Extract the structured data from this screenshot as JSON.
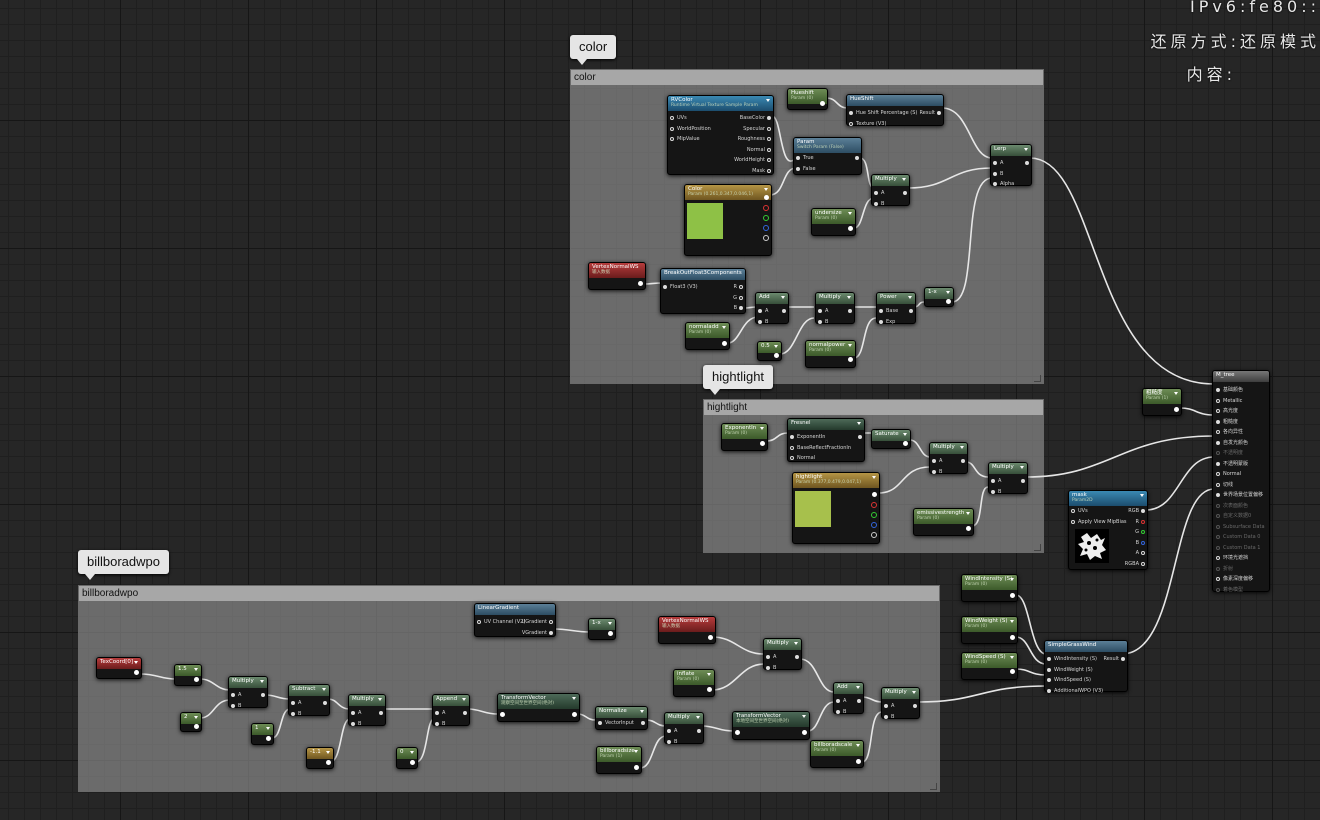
{
  "overlay": {
    "line1": "IPv6:fe80::",
    "line2": "还原方式:还原模式",
    "line3": "内容:"
  },
  "comments": {
    "color": {
      "bubble": "color",
      "header": "color"
    },
    "hightlight": {
      "bubble": "hightlight",
      "header": "hightlight"
    },
    "billboradwpo": {
      "bubble": "billboradwpo",
      "header": "billboradwpo"
    }
  },
  "nodes": {
    "rvt": {
      "title": "RVColor",
      "sub": "Runtime Virtual Texture Sample Param",
      "in": [
        "UVs",
        "WorldPosition",
        "MipValue"
      ],
      "out": [
        "BaseColor",
        "Specular",
        "Roughness",
        "Normal",
        "WorldHeight",
        "Mask"
      ]
    },
    "hueshift_param": {
      "title": "Hueshift",
      "sub": "Param (0)"
    },
    "hueshift": {
      "title": "HueShift",
      "in": [
        "Hue Shift Percentage (S)",
        "Texture (V3)"
      ],
      "out": [
        "Result"
      ]
    },
    "switch_param": {
      "title": "Param",
      "sub": "Switch Param (False)",
      "in": [
        "True",
        "False"
      ]
    },
    "color": {
      "title": "Color",
      "sub": "Param (0.261,0.347,0.046,1)",
      "swatch": "#8ec146"
    },
    "multiply_c1": {
      "title": "Multiply",
      "in": [
        "A",
        "B"
      ]
    },
    "undersize": {
      "title": "undersize",
      "sub": "Param (0)"
    },
    "lerp": {
      "title": "Lerp",
      "in": [
        "A",
        "B",
        "Alpha"
      ]
    },
    "vertex_normal_1": {
      "title": "VertexNormalWS",
      "sub": "输入数据"
    },
    "breakout": {
      "title": "BreakOutFloat3Components",
      "in": [
        "Float3 (V3)"
      ],
      "out": [
        "R",
        "G",
        "B"
      ]
    },
    "add_c": {
      "title": "Add",
      "in": [
        "A",
        "B"
      ]
    },
    "multiply_c2": {
      "title": "Multiply",
      "in": [
        "A",
        "B"
      ]
    },
    "power": {
      "title": "Power",
      "in": [
        "Base",
        "Exp"
      ]
    },
    "one_minus_c": {
      "title": "1-x"
    },
    "normaladd": {
      "title": "normaladd",
      "sub": "Param (0)"
    },
    "const_05": {
      "title": "0.5"
    },
    "normalpower": {
      "title": "normalpower",
      "sub": "Param (0)"
    },
    "m_tree": {
      "title": "M_tree",
      "rows": [
        {
          "label": "基础颜色",
          "on": true,
          "dim": false
        },
        {
          "label": "Metallic",
          "on": false,
          "dim": false
        },
        {
          "label": "高光度",
          "on": false,
          "dim": false
        },
        {
          "label": "粗糙度",
          "on": true,
          "dim": false
        },
        {
          "label": "各向异性",
          "on": false,
          "dim": false
        },
        {
          "label": "自发光颜色",
          "on": true,
          "dim": false
        },
        {
          "label": "不透明度",
          "on": false,
          "dim": true
        },
        {
          "label": "不透明蒙版",
          "on": true,
          "dim": false
        },
        {
          "label": "Normal",
          "on": false,
          "dim": false
        },
        {
          "label": "切线",
          "on": false,
          "dim": false
        },
        {
          "label": "世界场景位置偏移",
          "on": true,
          "dim": false
        },
        {
          "label": "次表面颜色",
          "on": false,
          "dim": true
        },
        {
          "label": "自定义数据0",
          "on": false,
          "dim": true
        },
        {
          "label": "Subsurface Data",
          "on": false,
          "dim": true
        },
        {
          "label": "Custom Data 0",
          "on": false,
          "dim": true
        },
        {
          "label": "Custom Data 1",
          "on": false,
          "dim": true
        },
        {
          "label": "环境光遮挡",
          "on": false,
          "dim": false
        },
        {
          "label": "折射",
          "on": false,
          "dim": true
        },
        {
          "label": "像素深度偏移",
          "on": false,
          "dim": false
        },
        {
          "label": "着色模型",
          "on": false,
          "dim": true
        }
      ]
    },
    "roughness": {
      "title": "粗糙度",
      "sub": "Param (1)"
    },
    "exponentin": {
      "title": "ExponentIn",
      "sub": "Param (0)"
    },
    "fresnel": {
      "title": "Fresnel",
      "in": [
        "ExponentIn",
        "BaseReflectFractionIn",
        "Normal"
      ]
    },
    "saturate": {
      "title": "Saturate"
    },
    "multiply_h1": {
      "title": "Multiply",
      "in": [
        "A",
        "B"
      ]
    },
    "multiply_h2": {
      "title": "Multiply",
      "in": [
        "A",
        "B"
      ]
    },
    "hightlight": {
      "title": "hightlight",
      "sub": "Param (0.377,0.479,0.047,1)",
      "swatch": "#a7c04c"
    },
    "emissive": {
      "title": "emissivestrength",
      "sub": "Param (0)"
    },
    "mask": {
      "title": "mask",
      "sub": "Param2D",
      "in": [
        "UVs",
        "Apply View MipBias"
      ],
      "out": [
        "RGB",
        "R",
        "G",
        "B",
        "A",
        "RGBA"
      ]
    },
    "wind_intensity": {
      "title": "WindIntensity (S)",
      "sub": "Param (0)"
    },
    "wind_weight": {
      "title": "WindWeight (S)",
      "sub": "Param (0)"
    },
    "wind_speed": {
      "title": "WindSpeed (S)",
      "sub": "Param (0)"
    },
    "simplegrass": {
      "title": "SimpleGrassWind",
      "in": [
        "WindIntensity (S)",
        "WindWeight (S)",
        "WindSpeed (S)",
        "AdditionalWPO (V3)"
      ],
      "out": [
        "Result"
      ]
    },
    "texcoord": {
      "title": "TexCoord[0]"
    },
    "const_1_a": {
      "title": "1.5"
    },
    "const_2": {
      "title": "2"
    },
    "multiply_b1": {
      "title": "Multiply",
      "in": [
        "A",
        "B"
      ]
    },
    "subtract": {
      "title": "Subtract",
      "in": [
        "A",
        "B"
      ]
    },
    "const_1_b": {
      "title": "1"
    },
    "multiply_b2": {
      "title": "Multiply",
      "in": [
        "A",
        "B"
      ]
    },
    "const_neg1": {
      "title": "-1.1"
    },
    "append": {
      "title": "Append",
      "in": [
        "A",
        "B"
      ]
    },
    "const_0": {
      "title": "0"
    },
    "lineargradient": {
      "title": "LinearGradient",
      "in": [
        "UV Channel (V2)"
      ],
      "out": [
        "UGradient",
        "VGradient"
      ]
    },
    "one_minus_b": {
      "title": "1-x"
    },
    "transform1": {
      "title": "TransformVector",
      "sub": "观察空间至世界空间(绝对)"
    },
    "normalize": {
      "title": "Normalize",
      "in": [
        "VectorInput"
      ]
    },
    "vertex_normal_2": {
      "title": "VertexNormalWS",
      "sub": "输入数据"
    },
    "multiply_b3": {
      "title": "Multiply",
      "in": [
        "A",
        "B"
      ]
    },
    "inflate": {
      "title": "inflate",
      "sub": "Param (0)"
    },
    "multiply_b4": {
      "title": "Multiply",
      "in": [
        "A",
        "B"
      ]
    },
    "transform2": {
      "title": "TransformVector",
      "sub": "本地空间至世界空间(绝对)"
    },
    "billboradsize": {
      "title": "billboradsize",
      "sub": "Param (1)"
    },
    "add_b": {
      "title": "Add",
      "in": [
        "A",
        "B"
      ]
    },
    "billboradscale": {
      "title": "billboradscale",
      "sub": "Param (0)"
    },
    "multiply_b5": {
      "title": "Multiply",
      "in": [
        "A",
        "B"
      ]
    }
  },
  "colors": {
    "param_header": "#5d7e47",
    "function_header": "#3d6580",
    "input_header": "#a33232",
    "color_param_header": "#a08238",
    "texture_header": "#2f7ba6",
    "wire": "#e6e6e6",
    "comment_fill": "#8f8f8f"
  }
}
